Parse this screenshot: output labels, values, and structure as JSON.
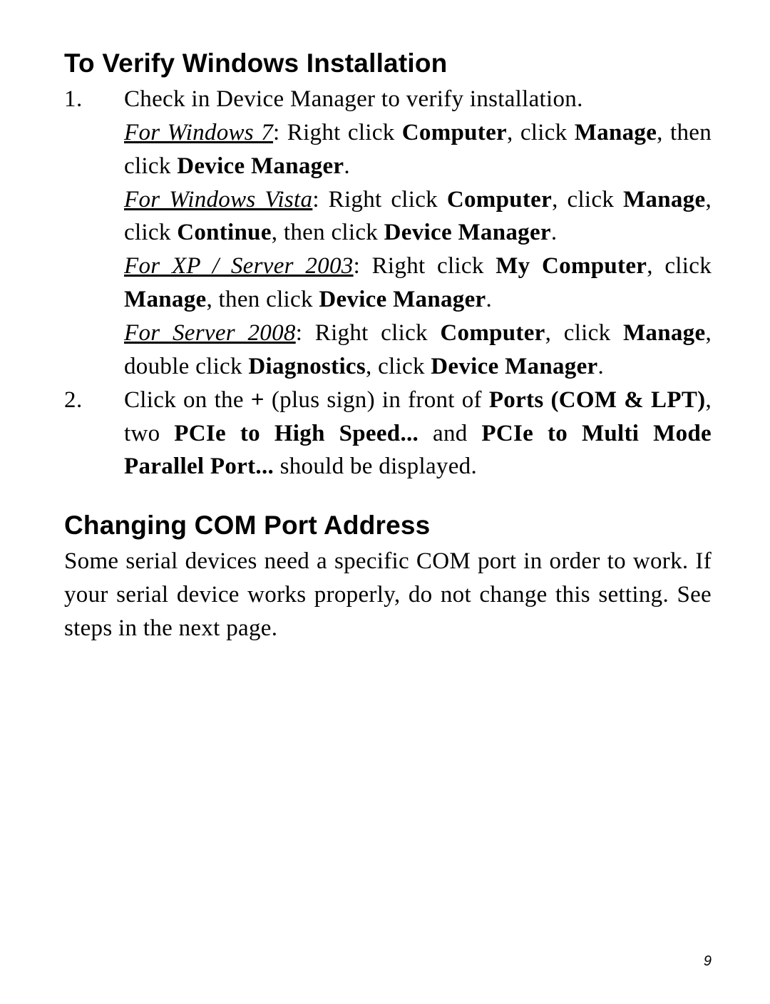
{
  "section1": {
    "heading": "To Verify Windows Installation",
    "step1": {
      "intro": "Check in Device Manager to verify installation.",
      "win7": {
        "label": "For Windows 7",
        "sep": ": Right click ",
        "b1": "Computer",
        "t1": ", click ",
        "b2": "Manage",
        "t2": ", then click ",
        "b3": "Device Manager",
        "end": "."
      },
      "vista": {
        "label": "For Windows Vista",
        "sep": ": Right click ",
        "b1": "Computer",
        "t1": ", click ",
        "b2": "Manage",
        "t2": ", click ",
        "b3": "Continue",
        "t3": ", then click ",
        "b4": "Device Manager",
        "end": "."
      },
      "xp": {
        "label": "For XP / Server 2003",
        "sep": ": Right click ",
        "b1": "My Computer",
        "t1": ", click ",
        "b2": "Manage",
        "t2": ", then click ",
        "b3": "Device Manager",
        "end": "."
      },
      "s2008": {
        "label": "For Server 2008",
        "sep": ": Right click ",
        "b1": "Computer",
        "t1": ", click ",
        "b2": "Manage",
        "t2": ", double click ",
        "b3": "Diagnostics",
        "t3": ", click ",
        "b4": "Device Manager",
        "end": "."
      }
    },
    "step2": {
      "t0": "Click on the ",
      "b1": "+",
      "t1": " (plus sign) in front of ",
      "b2": "Ports (COM & LPT)",
      "t2": ", two ",
      "b3": "PCIe to High Speed...",
      "t3": " and ",
      "b4": "PCIe to Multi Mode Parallel Port...",
      "t4": " should be displayed."
    }
  },
  "section2": {
    "heading": "Changing COM Port Address",
    "intro": "Some serial devices need a specific COM port in order to work. If your serial device works properly, do not change this setting. See steps in the next page."
  },
  "pageNumber": "9"
}
